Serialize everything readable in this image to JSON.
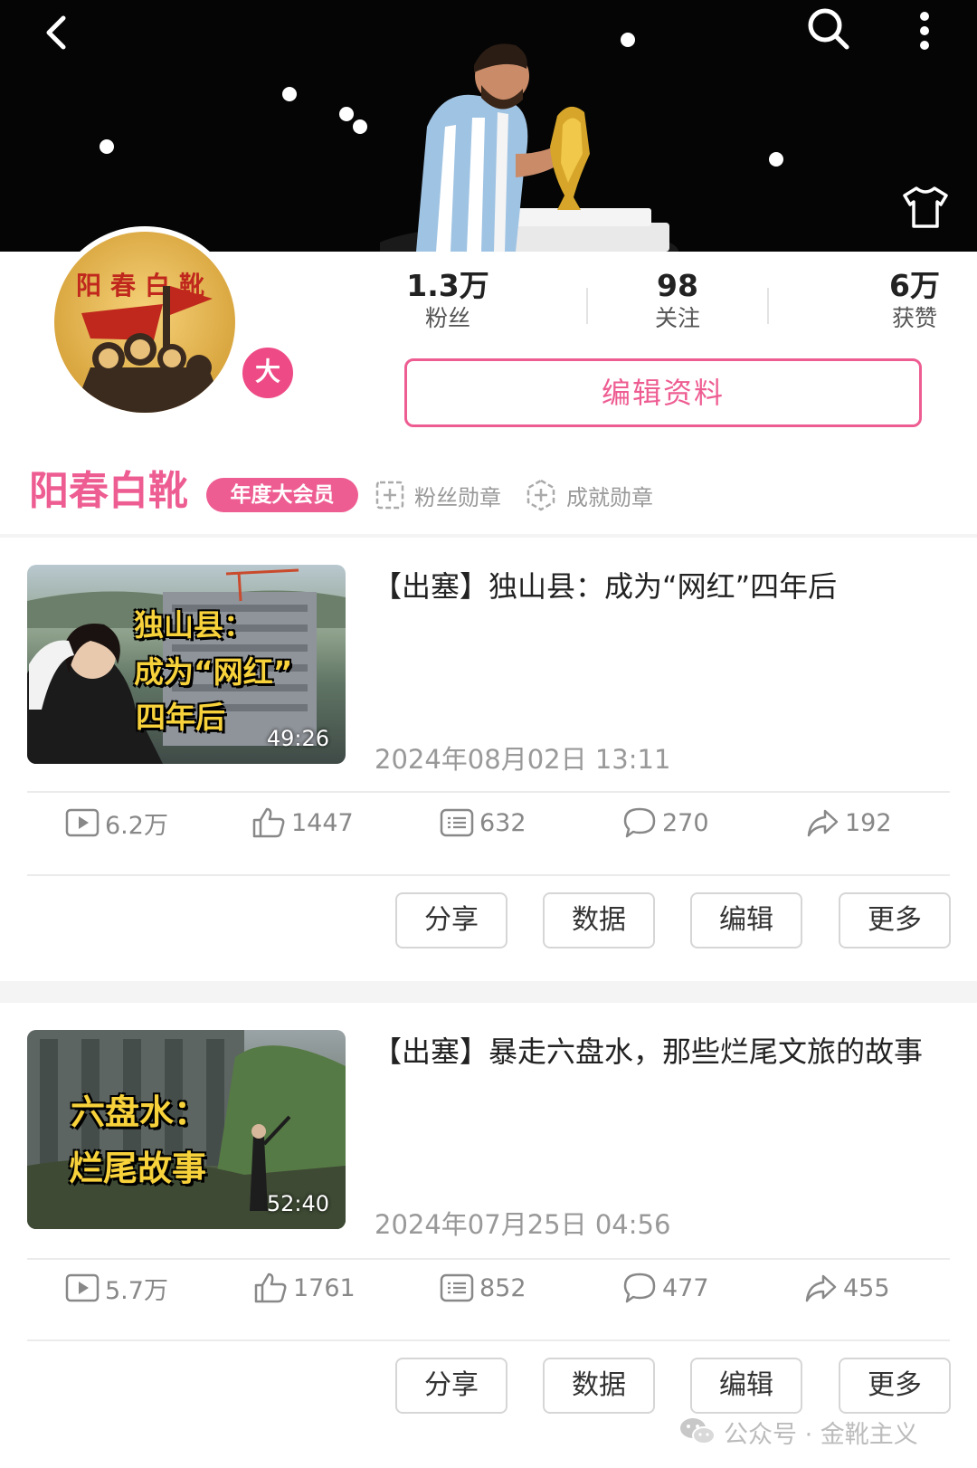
{
  "header": {
    "back_icon": "chevron-left-icon",
    "search_icon": "search-icon",
    "more_icon": "more-vertical-icon",
    "skin_icon": "tshirt-icon"
  },
  "profile": {
    "avatar_text": "阳春白靴",
    "vip_mark": "大",
    "stats": [
      {
        "value": "1.3万",
        "label": "粉丝"
      },
      {
        "value": "98",
        "label": "关注"
      },
      {
        "value": "6万",
        "label": "获赞"
      }
    ],
    "edit_label": "编辑资料",
    "name": "阳春白靴",
    "membership": "年度大会员",
    "medals": [
      "粉丝勋章",
      "成就勋章"
    ]
  },
  "colors": {
    "accent": "#ee5d92",
    "banner": "#050505",
    "thumb_text": "#f7d23b"
  },
  "videos": [
    {
      "thumb_lines": [
        "独山县：",
        "成为“网红”",
        "四年后"
      ],
      "duration": "49:26",
      "title": "【出塞】独山县：成为“网红”四年后",
      "date": "2024年08月02日 13:11",
      "metrics": {
        "plays": "6.2万",
        "likes": "1447",
        "danmaku": "632",
        "comments": "270",
        "shares": "192"
      },
      "actions": [
        "分享",
        "数据",
        "编辑",
        "更多"
      ]
    },
    {
      "thumb_lines": [
        "六盘水：",
        "烂尾故事"
      ],
      "duration": "52:40",
      "title": "【出塞】暴走六盘水，那些烂尾文旅的故事",
      "date": "2024年07月25日 04:56",
      "metrics": {
        "plays": "5.7万",
        "likes": "1761",
        "danmaku": "852",
        "comments": "477",
        "shares": "455"
      },
      "actions": [
        "分享",
        "数据",
        "编辑",
        "更多"
      ]
    }
  ],
  "watermark": "公众号 · 金靴主义"
}
